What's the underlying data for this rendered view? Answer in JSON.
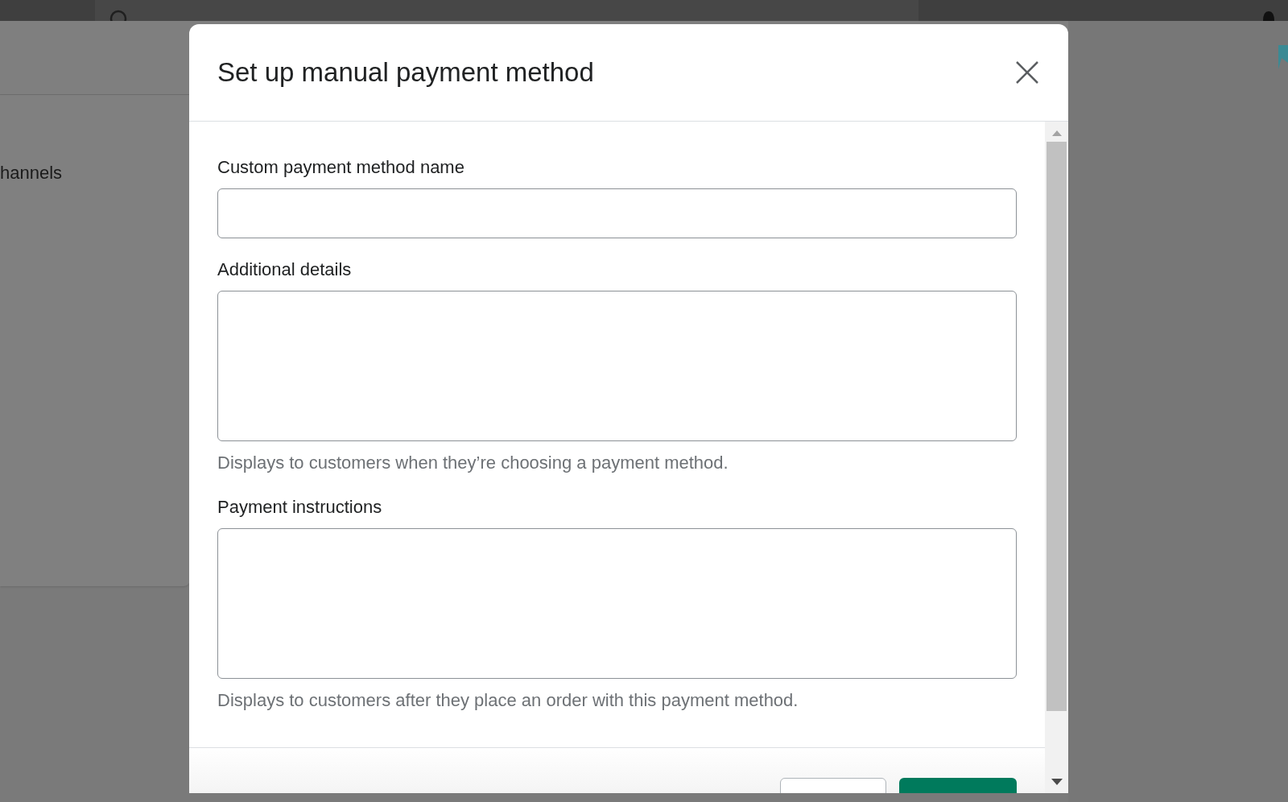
{
  "background": {
    "section_title": "hannels"
  },
  "modal": {
    "title": "Set up manual payment method",
    "fields": [
      {
        "kind": "input",
        "label": "Custom payment method name"
      },
      {
        "kind": "textarea",
        "label": "Additional details",
        "help": "Displays to customers when they’re choosing a payment method."
      },
      {
        "kind": "textarea",
        "label": "Payment instructions",
        "help": "Displays to customers after they place an order with this payment method."
      }
    ],
    "footer_buttons": [
      {
        "kind": "secondary"
      },
      {
        "kind": "primary"
      }
    ]
  }
}
